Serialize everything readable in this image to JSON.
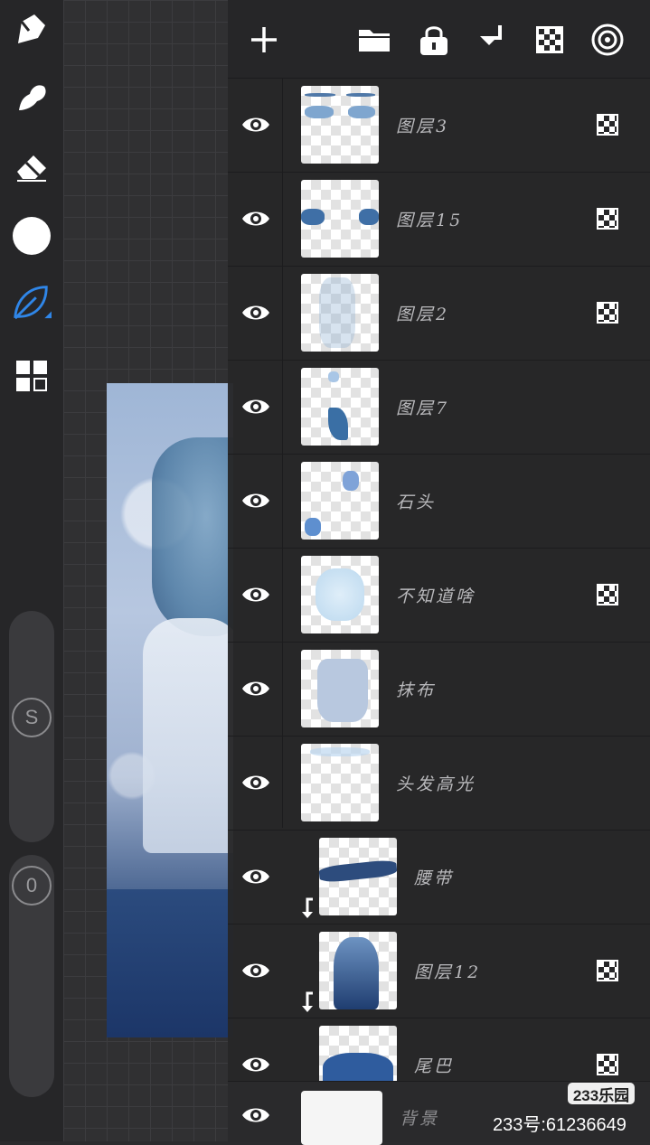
{
  "toolbar": {
    "tools": [
      "brush-icon",
      "smudge-icon",
      "eraser-icon",
      "color-swatch",
      "leaf-brush-icon",
      "layers-grid-icon"
    ],
    "size_slider_label": "S",
    "opacity_slider_label": "0",
    "active_color": "#ffffff",
    "accent_color": "#2f86e8"
  },
  "layer_panel": {
    "header_buttons": [
      "add-icon",
      "folder-icon",
      "lock-icon",
      "merge-down-icon",
      "checker-icon",
      "target-icon"
    ],
    "layers": [
      {
        "name": "图层3",
        "visible": true,
        "blend_icon": true,
        "clipped": false
      },
      {
        "name": "图层15",
        "visible": true,
        "blend_icon": true,
        "clipped": false
      },
      {
        "name": "图层2",
        "visible": true,
        "blend_icon": true,
        "clipped": false
      },
      {
        "name": "图层7",
        "visible": true,
        "blend_icon": false,
        "clipped": false
      },
      {
        "name": "石头",
        "visible": true,
        "blend_icon": false,
        "clipped": false
      },
      {
        "name": "不知道啥",
        "visible": true,
        "blend_icon": true,
        "clipped": false
      },
      {
        "name": "抹布",
        "visible": true,
        "blend_icon": false,
        "clipped": false
      },
      {
        "name": "头发高光",
        "visible": true,
        "blend_icon": false,
        "clipped": false
      },
      {
        "name": "腰带",
        "visible": true,
        "blend_icon": false,
        "clipped": true
      },
      {
        "name": "图层12",
        "visible": true,
        "blend_icon": true,
        "clipped": true
      },
      {
        "name": "尾巴",
        "visible": true,
        "blend_icon": true,
        "clipped": false
      }
    ],
    "background_layer": {
      "name": "背景",
      "visible": true
    }
  },
  "watermark": {
    "logo": "233乐园",
    "id_text": "233号:61236649"
  }
}
